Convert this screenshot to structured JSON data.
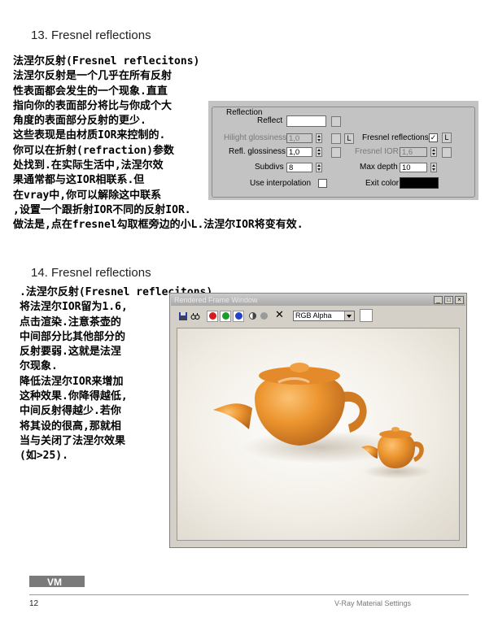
{
  "sections": [
    {
      "heading": "13. Fresnel reflections",
      "lines": [
        "法涅尔反射(Fresnel reflecitons)",
        "法涅尔反射是一个几乎在所有反射",
        "性表面都会发生的一个现象.直直",
        "指向你的表面部分将比与你成个大",
        "角度的表面部分反射的更少.",
        "这些表现是由材质IOR来控制的.",
        "你可以在折射(refraction)参数",
        "处找到.在实际生活中,法涅尔效",
        "果通常都与这IOR相联系.但",
        "在vray中,你可以解除这中联系",
        ",设置一个跟折射IOR不同的反射IOR.",
        "做法是,点在fresnel勾取框旁边的小L.法涅尔IOR将变有效."
      ]
    },
    {
      "heading": "14. Fresnel reflections",
      "lines": [
        ".法涅尔反射(Fresnel reflecitons)",
        "将法涅尔IOR留为1.6,",
        "点击渲染.注意茶壶的",
        "中间部分比其他部分的",
        "反射要弱.这就是法涅",
        "尔现象.",
        "降低法涅尔IOR来增加",
        "这种效果.你降得越低,",
        "中间反射得越少.若你",
        "将其设的很高,那就相",
        "当与关闭了法涅尔效果",
        "(如>25)."
      ]
    }
  ],
  "reflection_panel": {
    "group_title": "Reflection",
    "reflect_label": "Reflect",
    "hilight_label": "Hilight glossiness",
    "hilight_value": "1,0",
    "refl_gloss_label": "Refl. glossiness",
    "refl_gloss_value": "1,0",
    "subdivs_label": "Subdivs",
    "subdivs_value": "8",
    "use_interp_label": "Use interpolation",
    "fresnel_label": "Fresnel reflections",
    "fresnel_checked": "✓",
    "fresnel_ior_label": "Fresnel IOR",
    "fresnel_ior_value": "1,6",
    "max_depth_label": "Max depth",
    "max_depth_value": "10",
    "exit_color_label": "Exit color",
    "l_button": "L",
    "l_button_2": "L"
  },
  "frame_buffer": {
    "title": "Rendered Frame Window",
    "channel": "RGB Alpha",
    "minimize": "_",
    "maximize": "□",
    "close": "×",
    "clear_icon": "✕"
  },
  "footer": {
    "page_number": "12",
    "title": "V-Ray Material Settings",
    "logo_text": "VM"
  },
  "colors": {
    "teapot": "#e8922c",
    "rollout_bg": "#c3c3c3",
    "exit_color": "#000000"
  }
}
